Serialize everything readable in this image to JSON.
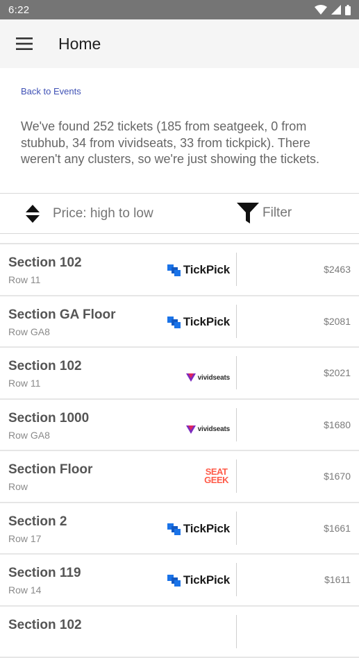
{
  "status_bar": {
    "time": "6:22"
  },
  "app_bar": {
    "title": "Home"
  },
  "back_link": "Back to Events",
  "summary": "We've found 252 tickets (185 from seatgeek, 0 from stubhub, 34 from vividseats, 33 from tickpick). There weren't any clusters, so we're just showing the tickets.",
  "sort": {
    "label": "Price: high to low"
  },
  "filter": {
    "label": "Filter"
  },
  "tickets": [
    {
      "section": "Section 102",
      "row": "Row 11",
      "source": "tickpick",
      "source_label": "TickPick",
      "price": "$2463"
    },
    {
      "section": "Section GA Floor",
      "row": "Row GA8",
      "source": "tickpick",
      "source_label": "TickPick",
      "price": "$2081"
    },
    {
      "section": "Section 102",
      "row": "Row 11",
      "source": "vividseats",
      "source_label": "vividseats",
      "price": "$2021"
    },
    {
      "section": "Section 1000",
      "row": "Row GA8",
      "source": "vividseats",
      "source_label": "vividseats",
      "price": "$1680"
    },
    {
      "section": "Section Floor",
      "row": "Row",
      "source": "seatgeek",
      "source_label": [
        "SEAT",
        "GEEK"
      ],
      "price": "$1670"
    },
    {
      "section": "Section 2",
      "row": "Row 17",
      "source": "tickpick",
      "source_label": "TickPick",
      "price": "$1661"
    },
    {
      "section": "Section 119",
      "row": "Row 14",
      "source": "tickpick",
      "source_label": "TickPick",
      "price": "$1611"
    },
    {
      "section": "Section 102",
      "row": "",
      "source": "",
      "source_label": "",
      "price": ""
    }
  ],
  "colors": {
    "link": "#3f51b5",
    "status_bar": "#757575",
    "tickpick_blue": "#1a73e8",
    "seatgeek_red": "#ff5b49"
  }
}
